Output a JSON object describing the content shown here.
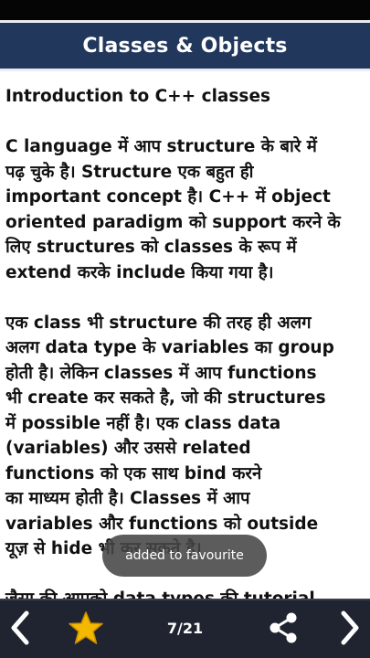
{
  "header": {
    "title": "Classes & Objects"
  },
  "content": {
    "heading": "Introduction to C++ classes",
    "paragraphs": [
      [
        "C language में आप structure के बारे में",
        "पढ़ चुके है। Structure एक बहुत ही",
        "important concept है। C++ में object",
        "oriented paradigm को support करने के",
        "लिए structures को classes के रूप में",
        "extend करके include किया गया है।"
      ],
      [
        "एक class भी structure की तरह ही अलग",
        "अलग data type के variables का group",
        "होती है। लेकिन classes में आप functions",
        "भी create कर सकते है, जो की structures",
        "में possible नहीं है। एक class data",
        "(variables) और उससे related",
        "functions को एक साथ bind करने",
        "का माध्यम होती है। Classes में आप",
        "variables और functions को outside",
        "यूज़ से hide भी कर सकते है।"
      ],
      [
        "जैसा की आपको data types की tutorial"
      ]
    ]
  },
  "toast": {
    "message": "added to favourite"
  },
  "footer": {
    "page_indicator": "7/21",
    "icons": {
      "prev": "chevron-left-icon",
      "favourite": "star-icon",
      "share": "share-icon",
      "next": "chevron-right-icon"
    }
  },
  "colors": {
    "title_bar": "#21375c",
    "bottom_bar": "#1f2430",
    "star": "#f5b800",
    "toast": "#464646"
  }
}
